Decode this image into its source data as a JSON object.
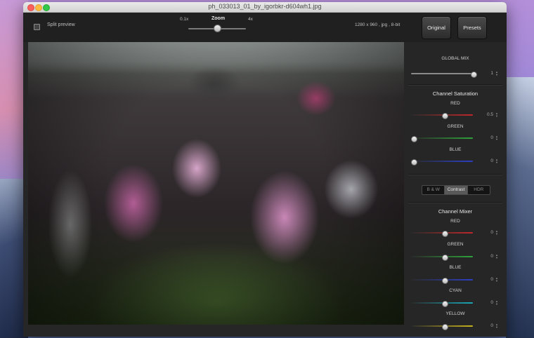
{
  "window": {
    "title": "ph_033013_01_by_igorbkr-d604wh1.jpg"
  },
  "toolbar": {
    "split_preview_label": "Split preview",
    "zoom_label": "Zoom",
    "zoom_min_label": "0.1x",
    "zoom_max_label": "4x",
    "zoom_level": 0.5,
    "image_info": "1280 x 960 , jpg , 8-bit",
    "original_button": "Original",
    "presets_button": "Presets"
  },
  "sidebar": {
    "global_mix": {
      "title": "GLOBAL MIX",
      "value": "1",
      "level": 0.97
    },
    "channel_saturation": {
      "title": "Channel Saturation",
      "red": {
        "label": "RED",
        "value": "0.5",
        "level": 0.5
      },
      "green": {
        "label": "GREEN",
        "value": "0",
        "level": 0.0
      },
      "blue": {
        "label": "BLUE",
        "value": "0",
        "level": 0.0
      }
    },
    "mode_tabs": [
      "B & W",
      "Contrast",
      "HDR"
    ],
    "active_tab": "Contrast",
    "channel_mixer": {
      "title": "Channel Mixer",
      "red": {
        "label": "RED",
        "value": "0",
        "level": 0.5
      },
      "green": {
        "label": "GREEN",
        "value": "0",
        "level": 0.5
      },
      "blue": {
        "label": "BLUE",
        "value": "0",
        "level": 0.5
      },
      "cyan": {
        "label": "CYAN",
        "value": "0",
        "level": 0.5
      },
      "yellow": {
        "label": "YELLOW",
        "value": "0",
        "level": 0.5
      }
    }
  },
  "colors": {
    "red": "#c0282a",
    "green": "#2fa33a",
    "blue": "#2b3fc4",
    "cyan": "#1aa7b6",
    "yellow": "#c7b31c"
  }
}
